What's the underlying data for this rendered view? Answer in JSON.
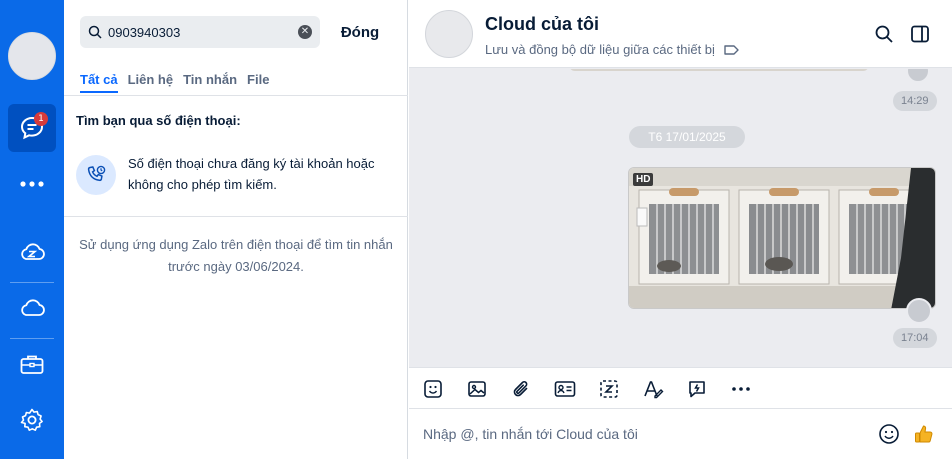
{
  "rail": {
    "chat_badge": "1"
  },
  "search": {
    "value": "0903940303",
    "placeholder": "",
    "close_label": "Đóng",
    "tabs": [
      "Tất cả",
      "Liên hệ",
      "Tin nhắn",
      "File"
    ],
    "phone_heading": "Tìm bạn qua số điện thoại:",
    "phone_notice": "Số điện thoại chưa đăng ký tài khoản hoặc không cho phép tìm kiếm.",
    "hint": "Sử dụng ứng dụng Zalo trên điện thoại để tìm tin nhắn trước ngày 03/06/2024."
  },
  "chat": {
    "title": "Cloud của tôi",
    "subtitle": "Lưu và đồng bộ dữ liệu giữa các thiết bị",
    "messages": {
      "time_1": "14:29",
      "date_divider": "T6 17/01/2025",
      "photo_badge": "HD",
      "time_2": "17:04"
    },
    "composer_placeholder": "Nhập @, tin nhắn tới Cloud của tôi"
  },
  "colors": {
    "accent": "#0a6ae8",
    "rail_active": "#0050c0",
    "badge": "#d63b3b",
    "tab_active": "#0a68ff"
  }
}
